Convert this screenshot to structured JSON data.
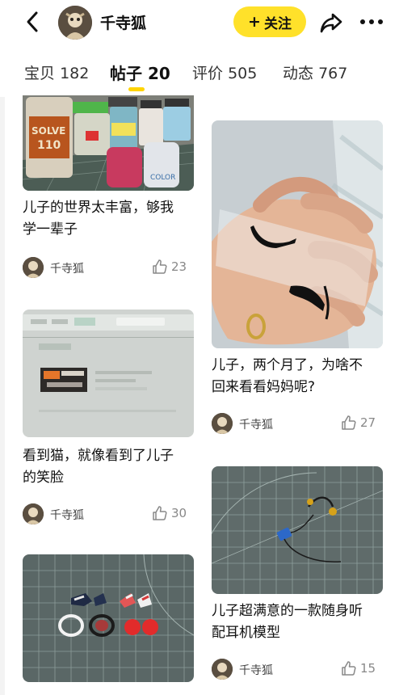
{
  "header": {
    "username": "千寺狐",
    "follow_label": "关注",
    "follow_plus": "+"
  },
  "tabs": [
    {
      "label": "宝贝",
      "count": "182"
    },
    {
      "label": "帖子",
      "count": "20"
    },
    {
      "label": "评价",
      "count": "505"
    },
    {
      "label": "动态",
      "count": "767"
    }
  ],
  "posts": [
    {
      "title_lines": [
        "儿子的世界太丰富，够我",
        "学一辈子"
      ],
      "author": "千寺狐",
      "likes": "23"
    },
    {
      "title_lines": [
        "儿子，两个月了，为啥不",
        "回来看看妈妈呢?"
      ],
      "author": "千寺狐",
      "likes": "27"
    },
    {
      "title_lines": [
        "看到猫，就像看到了儿子",
        "的笑脸"
      ],
      "author": "千寺狐",
      "likes": "30"
    },
    {
      "title_lines": [
        "儿子超满意的一款随身听",
        "配耳机模型"
      ],
      "author": "千寺狐",
      "likes": "15"
    }
  ],
  "icons": {
    "back": "back-arrow-icon",
    "share": "share-icon",
    "more": "more-dots-icon",
    "like": "thumbs-up-icon"
  },
  "colors": {
    "accent": "#ffe12a",
    "indicator": "#ffd400"
  }
}
